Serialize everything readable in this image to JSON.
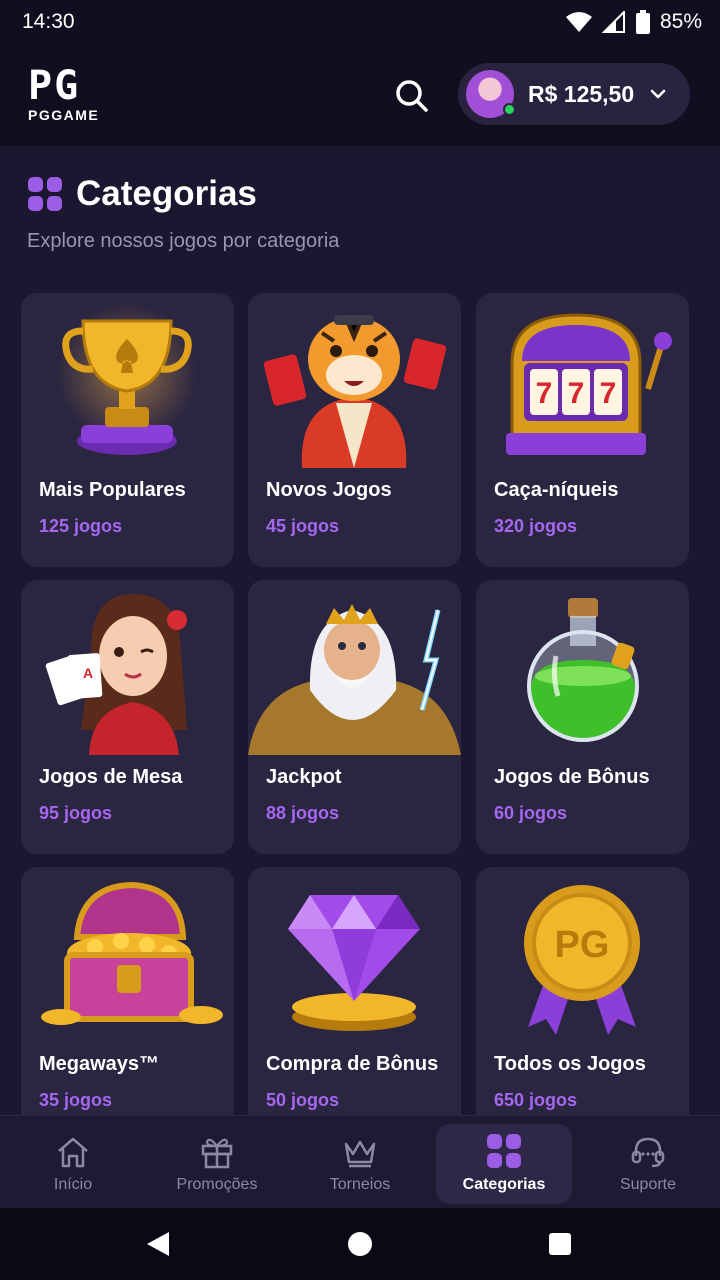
{
  "status_bar": {
    "time": "14:30",
    "battery": "85%",
    "icons": [
      "wifi-icon",
      "signal-icon",
      "battery-icon"
    ]
  },
  "header": {
    "logo_mark": "PG",
    "logo_text": "PGGAME",
    "balance": "R$ 125,50",
    "icons": [
      "search-icon",
      "avatar",
      "chevron-down-icon"
    ]
  },
  "page": {
    "title": "Categorias",
    "subtitle": "Explore nossos jogos por categoria",
    "title_icon": "grid-icon"
  },
  "categories": [
    {
      "name": "Mais Populares",
      "count": "125 jogos",
      "art": "trophy"
    },
    {
      "name": "Novos Jogos",
      "count": "45 jogos",
      "art": "tiger"
    },
    {
      "name": "Caça-níqueis",
      "count": "320 jogos",
      "art": "slot-machine"
    },
    {
      "name": "Jogos de Mesa",
      "count": "95 jogos",
      "art": "card-girl"
    },
    {
      "name": "Jackpot",
      "count": "88 jogos",
      "art": "zeus"
    },
    {
      "name": "Jogos de Bônus",
      "count": "60 jogos",
      "art": "potion"
    },
    {
      "name": "Megaways™",
      "count": "35 jogos",
      "art": "treasure-chest"
    },
    {
      "name": "Compra de Bônus",
      "count": "50 jogos",
      "art": "diamond"
    },
    {
      "name": "Todos os Jogos",
      "count": "650 jogos",
      "art": "pg-medal",
      "medal_text": "PG"
    }
  ],
  "bottom_nav": [
    {
      "label": "Início",
      "icon": "home-icon"
    },
    {
      "label": "Promoções",
      "icon": "gift-icon"
    },
    {
      "label": "Torneios",
      "icon": "crown-icon"
    },
    {
      "label": "Categorias",
      "icon": "grid-icon",
      "active": true
    },
    {
      "label": "Suporte",
      "icon": "headset-icon"
    }
  ],
  "system_nav": [
    "back-icon",
    "home-circle-icon",
    "recents-icon"
  ],
  "colors": {
    "background": "#1c1730",
    "card": "#2a2540",
    "accent": "#a667f0",
    "header": "#120e20"
  }
}
